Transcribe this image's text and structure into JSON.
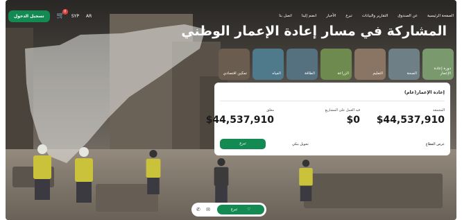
{
  "nav": {
    "login_label": "تسجيل الدخول",
    "cart_count": "0",
    "currency": "SYP",
    "language": "AR",
    "links": [
      "الصفحة الرئيسية",
      "عن الصندوق",
      "التقارير والبيانات",
      "تبرع",
      "الأخبار",
      "انضم إلينا",
      "اتصل بنا"
    ]
  },
  "hero": {
    "title": "المشاركة في مسار إعادة الإعمار الوطني"
  },
  "categories": [
    {
      "label": "دورة إعادة الإعمار",
      "color": "#7a9a6e"
    },
    {
      "label": "الصحة",
      "color": "#6f7f86"
    },
    {
      "label": "التعليم",
      "color": "#8a7463"
    },
    {
      "label": "الزراعة",
      "color": "#6f8a4e"
    },
    {
      "label": "الطاقة",
      "color": "#55707e"
    },
    {
      "label": "المياه",
      "color": "#4f7a8c"
    },
    {
      "label": "تمكين اقتصادي",
      "color": "#6a5d4f"
    }
  ],
  "card": {
    "heading": "إعادة الإعمار(عام)",
    "stats": [
      {
        "label": "المجمعة",
        "value": "$44,537,910"
      },
      {
        "label": "قيد العمل على المشاريع",
        "value": "$0"
      },
      {
        "label": "معلق",
        "value": "$44,537,910"
      }
    ],
    "range_label": "عرض القطاع",
    "transfer_label": "تحويل بنكي",
    "donate_label": "تبرع"
  },
  "bottom_bar": {
    "donate_label": "تبرع"
  }
}
